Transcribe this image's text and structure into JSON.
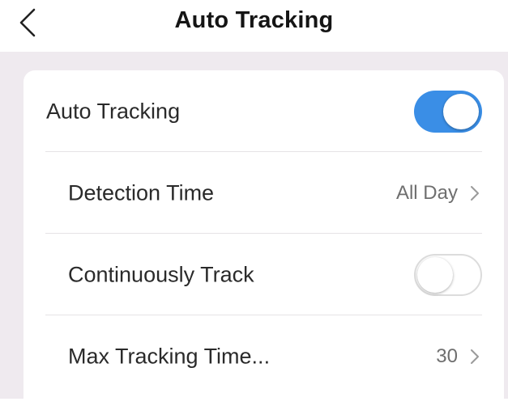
{
  "header": {
    "title": "Auto Tracking",
    "back_icon": "chevron-left-icon"
  },
  "colors": {
    "accent": "#3a8ee6",
    "background": "#efeaef",
    "card": "#ffffff"
  },
  "settings": {
    "auto_tracking": {
      "label": "Auto Tracking",
      "enabled": true
    },
    "detection_time": {
      "label": "Detection Time",
      "value": "All Day"
    },
    "continuously_track": {
      "label": "Continuously Track",
      "enabled": false
    },
    "max_tracking_time": {
      "label": "Max Tracking Time...",
      "value": "30"
    }
  }
}
